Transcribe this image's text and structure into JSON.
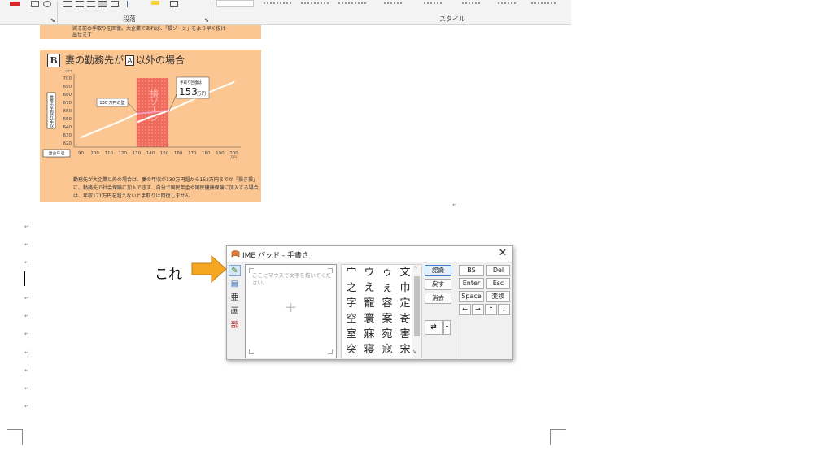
{
  "ribbon": {
    "group_paragraph": "段落",
    "group_styles": "スタイル"
  },
  "article": {
    "top_strip_text": "減る前の手取りを回復。大企業であれば、「損ゾーン」をより早く抜け出せます",
    "section_letter": "B",
    "title_part1": "妻の勤務先が",
    "title_box": "A",
    "title_part2": "以外の場合",
    "note": "勤務先が大企業以外の場合は、妻の年収が130万円超から152万円までが「損き損」に。勤務先で社会保険に加入できず、自分で国民年金や国民健康保険に加入する場合は、年収171万円を超えないと手取りは回復しません"
  },
  "chart_data": {
    "type": "line",
    "xlabel": "妻の年収",
    "x_unit": "万円",
    "ylabel": "世帯の手取り年収",
    "y_unit": "万円",
    "x_ticks": [
      90,
      100,
      110,
      120,
      130,
      140,
      150,
      160,
      170,
      180,
      190,
      200
    ],
    "y_ticks": [
      620,
      630,
      640,
      650,
      660,
      670,
      680,
      690,
      700
    ],
    "xlim": [
      85,
      205
    ],
    "ylim": [
      615,
      705
    ],
    "zone_range": [
      130,
      153
    ],
    "zone_label": "損ゾーン",
    "annotation_left": "130 万円の壁",
    "annotation_right_line1": "手取り回復は",
    "annotation_right_value": "153",
    "annotation_right_unit": "万円",
    "series": [
      {
        "x": [
          90,
          100,
          110,
          120,
          130,
          131,
          140,
          150,
          153,
          160,
          170,
          180,
          190,
          200
        ],
        "y": [
          627,
          634,
          641,
          648,
          656,
          646,
          652,
          658,
          660,
          665,
          673,
          681,
          688,
          695
        ]
      }
    ]
  },
  "callout": {
    "label": "これ"
  },
  "ime": {
    "title": "IME パッド - 手書き",
    "close_glyph": "✕",
    "draw_hint": "ここにマウスで文字を描いてください。",
    "side_buttons": [
      "✎",
      "▤",
      "亜",
      "画",
      "部"
    ],
    "candidates": [
      [
        "宀",
        "ウ",
        "ゥ",
        "文"
      ],
      [
        "之",
        "え",
        "ぇ",
        "巾"
      ],
      [
        "字",
        "寵",
        "容",
        "定"
      ],
      [
        "空",
        "寰",
        "案",
        "寄"
      ],
      [
        "室",
        "寐",
        "宛",
        "害"
      ],
      [
        "突",
        "寝",
        "寇",
        "宋"
      ]
    ],
    "btn_recognize": "認識",
    "btn_undo": "戻す",
    "btn_clear": "消去",
    "key_bs": "BS",
    "key_del": "Del",
    "key_enter": "Enter",
    "key_esc": "Esc",
    "key_space": "Space",
    "key_convert": "変換",
    "key_left": "←",
    "key_right": "→",
    "key_up": "↑",
    "key_down": "↓"
  }
}
